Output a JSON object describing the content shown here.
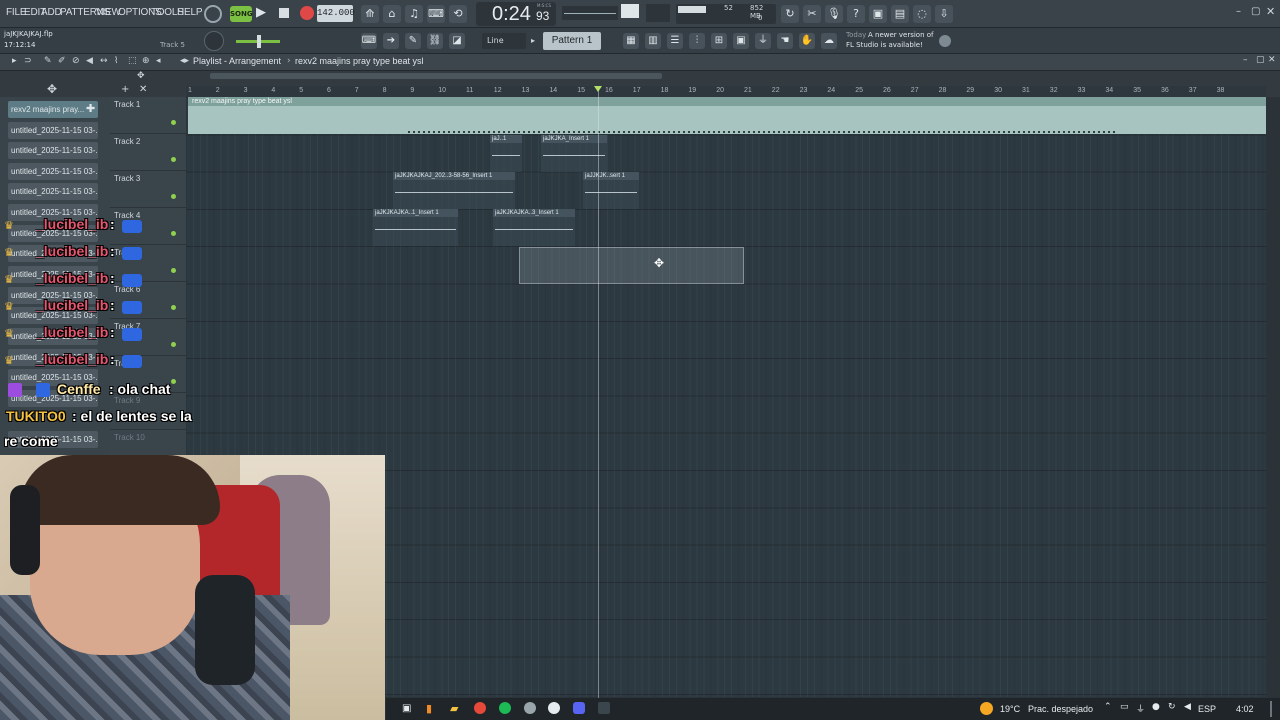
{
  "menu": [
    "FILE",
    "EDIT",
    "ADD",
    "PATTERNS",
    "VIEW",
    "OPTIONS",
    "TOOLS",
    "HELP"
  ],
  "transport": {
    "mode": "SONG",
    "tempo": "142.000",
    "time_main": "0:24",
    "time_sub": "93",
    "time_label": "M:S:CS"
  },
  "project": {
    "file": "jaJKJKAJKAJ.flp",
    "time": "17:12:14",
    "hint": "Track 5"
  },
  "meter": {
    "cpu": "52",
    "mem": "852 MB",
    "voices": "0"
  },
  "snap": "Line",
  "pattern": "Pattern 1",
  "news": {
    "line1_prefix": "Today",
    "line1": "A newer version of",
    "line2": "FL Studio is available!"
  },
  "playlist": {
    "title": "Playlist - Arrangement",
    "breadcrumb": "rexv2  maajins  pray type beat ysl"
  },
  "browser": {
    "items": [
      "rexv2  maajins  pray...",
      "untitled_2025-11-15 03-...",
      "untitled_2025-11-15 03-...",
      "untitled_2025-11-15 03-...",
      "untitled_2025-11-15 03-...",
      "untitled_2025-11-15 03-...",
      "untitled_2025-11-15 03-...",
      "untitled_2025-11-15 03-...",
      "untitled_2025-11-15 03-...",
      "untitled_2025-11-15 03-...",
      "untitled_2025-11-15 03-...",
      "untitled_2025-11-15 03-...",
      "untitled_2025-11-15 03-...",
      "untitled_2025-11-15 03-...",
      "untitled_2025-11-15 03-...",
      "untitled_2025-11-15 03-..."
    ]
  },
  "tracks": [
    "Track 1",
    "Track 2",
    "Track 3",
    "Track 4",
    "Track 5",
    "Track 6",
    "Track 7",
    "Track 8",
    "Track 9",
    "Track 10"
  ],
  "ruler": [
    "1",
    "2",
    "3",
    "4",
    "5",
    "6",
    "7",
    "8",
    "9",
    "10",
    "11",
    "12",
    "13",
    "14",
    "15",
    "16",
    "17",
    "18",
    "19",
    "20",
    "21",
    "22",
    "23",
    "24",
    "25",
    "26",
    "27",
    "28",
    "29",
    "30",
    "31",
    "32",
    "33",
    "34",
    "35",
    "36",
    "37",
    "38"
  ],
  "clips": {
    "audio": "rexv2  maajins  pray type beat ysl",
    "t2a": "jaJ..1",
    "t2b": "jaJKJKA_Insert 1",
    "t3a": "jaJKJKAJKAJ_202..3-58-56_Insert 1",
    "t3b": "jaJJKJK..sert 1",
    "t4a": "jaJKJKAJKA..1_Insert 1",
    "t4b": "jaJKJKAJKA..3_Insert 1"
  },
  "chat": {
    "user_repeat": "_lucibel_ib",
    "sep": ":",
    "msg1_user": "Cenffe",
    "msg1_text": ": ola chat",
    "msg2_user": "TUKITO0",
    "msg2_text": ": el de lentes se la",
    "msg2_cont": "re come"
  },
  "taskbar": {
    "weather_temp": "19°C",
    "weather_text": "Prac. despejado",
    "lang": "ESP",
    "clock": "4:02"
  }
}
